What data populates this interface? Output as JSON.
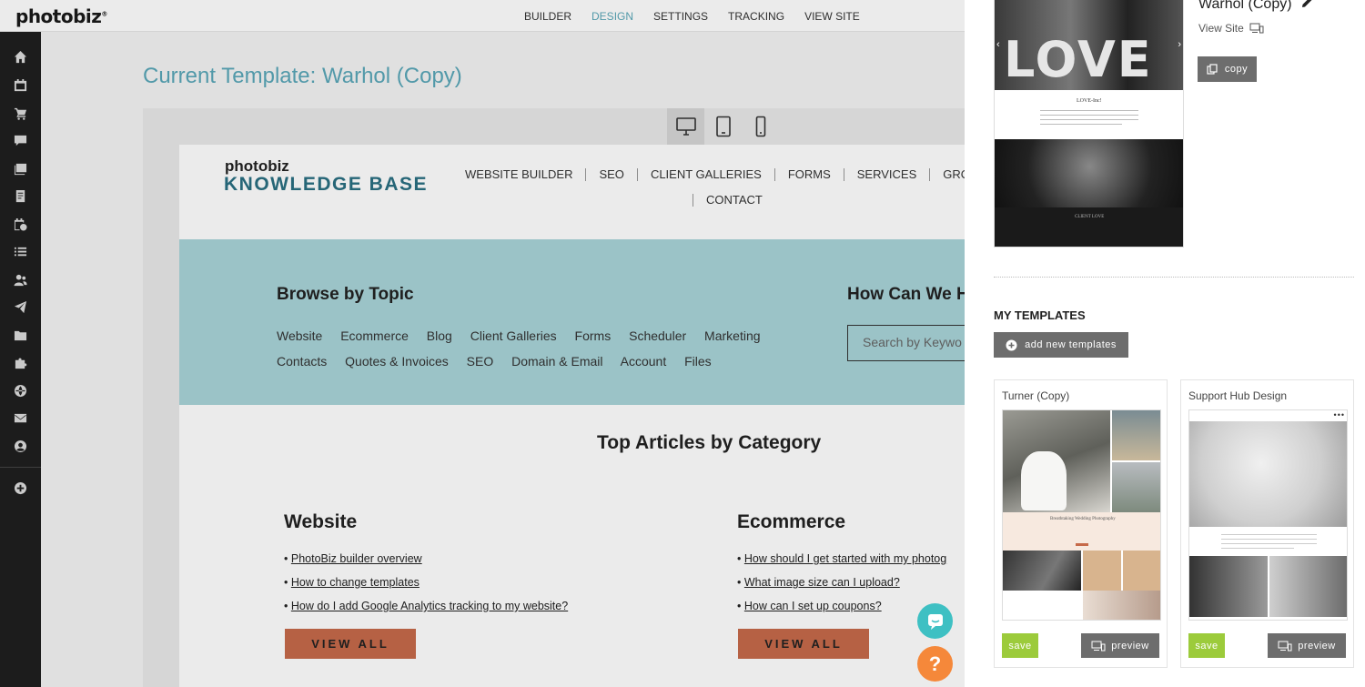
{
  "app": {
    "logo": "photobiz",
    "nav": [
      {
        "label": "BUILDER",
        "active": false
      },
      {
        "label": "DESIGN",
        "active": true
      },
      {
        "label": "SETTINGS",
        "active": false
      },
      {
        "label": "TRACKING",
        "active": false
      },
      {
        "label": "VIEW SITE",
        "active": false
      }
    ],
    "accent_color": "#59a7b8"
  },
  "sidebar": {
    "icons": [
      "home-icon",
      "calendar-icon",
      "cart-icon",
      "chat-icon",
      "gallery-icon",
      "document-icon",
      "scheduler-icon",
      "list-icon",
      "contacts-icon",
      "send-icon",
      "folder-icon",
      "puzzle-icon",
      "globe-icon",
      "mail-icon",
      "account-icon",
      "add-icon"
    ]
  },
  "main": {
    "current_template_title": "Current Template: Warhol (Copy)",
    "devices": [
      "desktop-icon",
      "tablet-icon",
      "mobile-icon"
    ],
    "active_device": "desktop"
  },
  "site": {
    "brand_top": "photobiz",
    "brand_bottom": "KNOWLEDGE BASE",
    "nav_row1": [
      "WEBSITE BUILDER",
      "SEO",
      "CLIENT GALLERIES",
      "FORMS",
      "SERVICES",
      "GROW"
    ],
    "nav_row2": [
      "CONTACT"
    ],
    "browse_title": "Browse by Topic",
    "topics": [
      "Website",
      "Ecommerce",
      "Blog",
      "Client Galleries",
      "Forms",
      "Scheduler",
      "Marketing",
      "Contacts",
      "Quotes & Invoices",
      "SEO",
      "Domain & Email",
      "Account",
      "Files"
    ],
    "help_title": "How Can We H",
    "search_placeholder": "Search by Keywo",
    "browse_bg": "#a9d4d8",
    "top_articles_title": "Top Articles by Category",
    "categories": [
      {
        "title": "Website",
        "articles": [
          "PhotoBiz builder overview",
          "How to change templates",
          "How do I add Google Analytics tracking to my website?"
        ],
        "button": "VIEW ALL"
      },
      {
        "title": "Ecommerce",
        "articles": [
          "How should I get started with my photog",
          "What image size can I upload?",
          "How can I set up coupons?"
        ],
        "button": "VIEW ALL"
      }
    ],
    "button_color": "#c66a4a"
  },
  "panel": {
    "current": {
      "name": "Warhol (Copy)",
      "view_site": "View Site",
      "copy_label": "copy",
      "thumb_word": "LOVE",
      "thumb_text1": "LOVE-Inc!",
      "thumb_text2": "CLIENT LOVE"
    },
    "my_templates_title": "MY TEMPLATES",
    "add_label": "add new templates",
    "templates": [
      {
        "name": "Turner (Copy)",
        "save": "save",
        "preview": "preview",
        "thumb_text": "Breathtaking Wedding Photography"
      },
      {
        "name": "Support Hub Design",
        "save": "save",
        "preview": "preview"
      }
    ],
    "save_color": "#9ccb3b",
    "button_gray": "#6d6d6d"
  },
  "floating": {
    "chat_color": "#3ec0c3",
    "help_color": "#f5883a",
    "help_label": "?"
  }
}
